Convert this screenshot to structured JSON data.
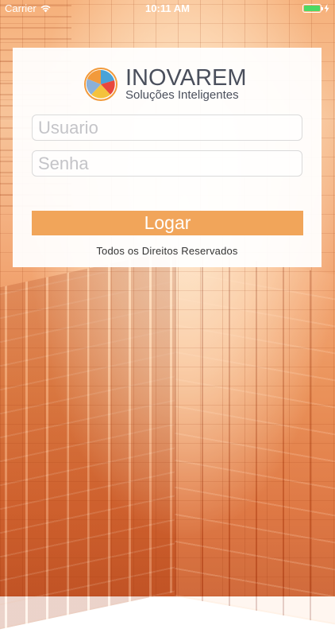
{
  "status_bar": {
    "carrier": "Carrier",
    "time": "10:11 AM",
    "battery_color": "#4cd964",
    "icons": [
      "wifi-icon",
      "battery-icon",
      "charging-icon"
    ]
  },
  "login": {
    "logo": {
      "title": "INOVAREM",
      "subtitle": "Soluções Inteligentes",
      "mark_icon": "pie-chart-logo-icon",
      "mark_colors": [
        "#f29a3b",
        "#4aa3d8",
        "#e9473c",
        "#f4c23d",
        "#8bb0d8"
      ]
    },
    "username": {
      "placeholder": "Usuario",
      "value": ""
    },
    "password": {
      "placeholder": "Senha",
      "value": ""
    },
    "button_label": "Logar",
    "button_color": "#f1a55a",
    "footer": "Todos os Direitos Reservados"
  }
}
